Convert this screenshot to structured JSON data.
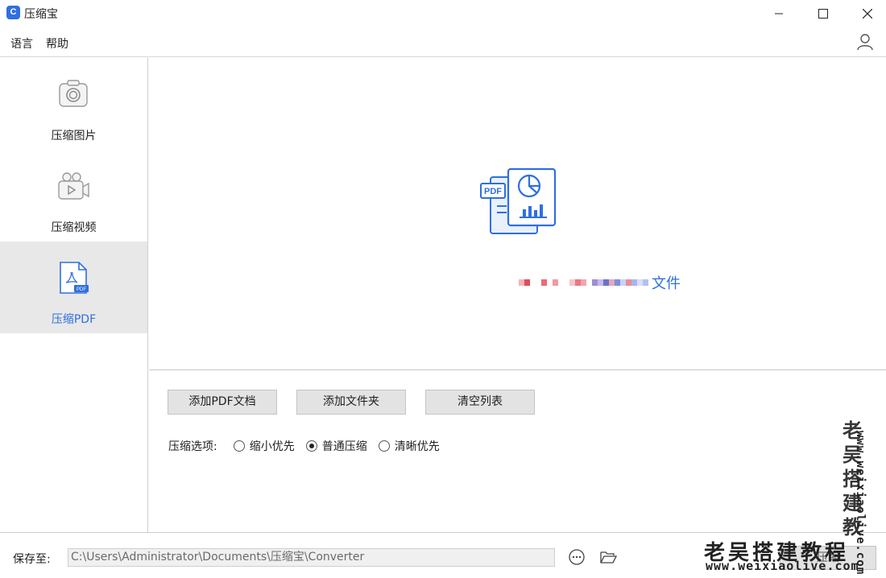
{
  "titlebar": {
    "app_title": "压缩宝",
    "logo_letter": "C"
  },
  "menu": {
    "language": "语言",
    "help": "帮助"
  },
  "sidebar": {
    "items": [
      {
        "label": "压缩图片",
        "icon": "camera-icon",
        "active": false
      },
      {
        "label": "压缩视频",
        "icon": "video-camera-icon",
        "active": false
      },
      {
        "label": "压缩PDF",
        "icon": "pdf-file-icon",
        "active": true
      }
    ]
  },
  "dropzone": {
    "illustration": "pdf-document-chart-icon",
    "text_suffix": "文件"
  },
  "buttons": {
    "add_pdf": "添加PDF文档",
    "add_folder": "添加文件夹",
    "clear_list": "清空列表"
  },
  "options": {
    "label": "压缩选项:",
    "choices": [
      "缩小优先",
      "普通压缩",
      "清晰优先"
    ],
    "selected": "普通压缩"
  },
  "footer": {
    "save_label": "保存至:",
    "save_path": "C:\\Users\\Administrator\\Documents\\压缩宝\\Converter",
    "compress_label": "压缩"
  },
  "watermark": {
    "text": "老吴搭建教程",
    "vertical_chars": [
      "老",
      "吴",
      "搭",
      "建",
      "教"
    ],
    "url": "www.weixiaolive.com"
  },
  "colors": {
    "accent": "#2f6fe0",
    "active_bg": "#e8e8e8"
  }
}
